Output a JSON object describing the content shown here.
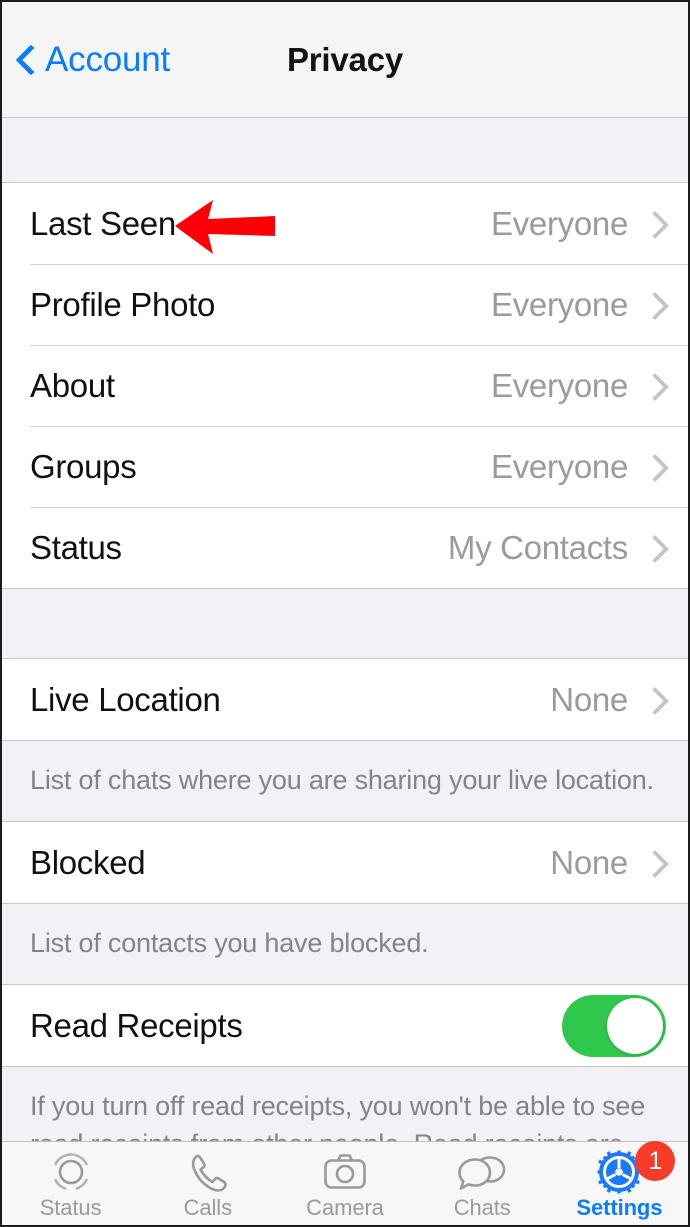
{
  "navbar": {
    "back_label": "Account",
    "title": "Privacy"
  },
  "sections": {
    "privacy_rows": [
      {
        "label": "Last Seen",
        "value": "Everyone"
      },
      {
        "label": "Profile Photo",
        "value": "Everyone"
      },
      {
        "label": "About",
        "value": "Everyone"
      },
      {
        "label": "Groups",
        "value": "Everyone"
      },
      {
        "label": "Status",
        "value": "My Contacts"
      }
    ],
    "live_location": {
      "label": "Live Location",
      "value": "None",
      "footnote": "List of chats where you are sharing your live location."
    },
    "blocked": {
      "label": "Blocked",
      "value": "None",
      "footnote": "List of contacts you have blocked."
    },
    "read_receipts": {
      "label": "Read Receipts",
      "toggle_state": "on",
      "footnote": "If you turn off read receipts, you won't be able to see read receipts from other people. Read receipts are"
    }
  },
  "tabbar": {
    "items": [
      {
        "label": "Status",
        "icon": "status-rings-icon",
        "active": false
      },
      {
        "label": "Calls",
        "icon": "phone-handset-icon",
        "active": false
      },
      {
        "label": "Camera",
        "icon": "camera-icon",
        "active": false
      },
      {
        "label": "Chats",
        "icon": "speech-bubbles-icon",
        "active": false
      },
      {
        "label": "Settings",
        "icon": "gear-icon",
        "active": true,
        "badge": "1"
      }
    ]
  },
  "annotation": {
    "arrow": "red-left-arrow",
    "points_at": "Last Seen"
  },
  "colors": {
    "accent_blue": "#0a7cff",
    "toggle_green": "#2fc84c",
    "badge_red": "#f93b27",
    "annotation_red": "#fb0007",
    "group_background": "#f1f1f6",
    "row_background": "#ffffff",
    "value_gray": "#9b9b9f",
    "footnote_gray": "#848488"
  }
}
